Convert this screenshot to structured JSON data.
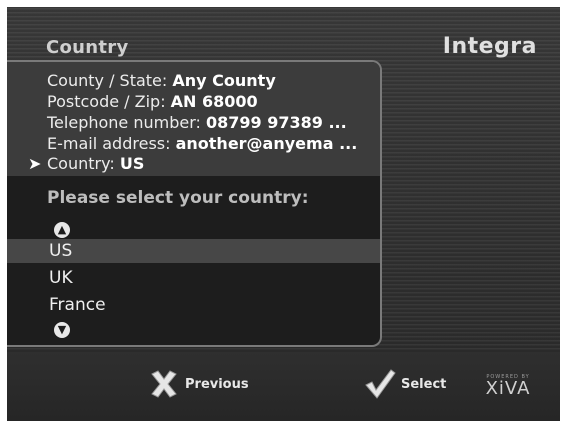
{
  "header": {
    "title": "Country",
    "logo": "Integra"
  },
  "fields": [
    {
      "label": "County / State: ",
      "value": "Any County"
    },
    {
      "label": "Postcode / Zip: ",
      "value": "AN 68000"
    },
    {
      "label": "Telephone number: ",
      "value": "08799 97389 ..."
    },
    {
      "label": "E-mail address: ",
      "value": "another@anyema ..."
    },
    {
      "label": "Country: ",
      "value": "US"
    }
  ],
  "cursor_glyph": "➤",
  "prompt": "Please select your country:",
  "scroll": {
    "up_glyph": "▲",
    "down_glyph": "▼"
  },
  "country_list": {
    "items": [
      "US",
      "UK",
      "France"
    ],
    "selected": "US"
  },
  "footer": {
    "previous_label": "Previous",
    "select_label": "Select",
    "powered_by": "POWERED BY",
    "brand": "XiVA"
  }
}
